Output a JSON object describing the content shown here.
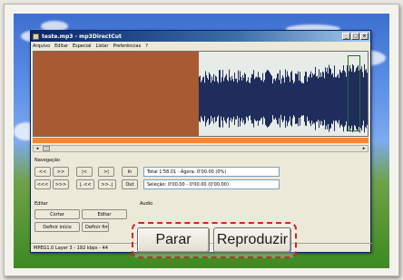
{
  "window": {
    "title": "teste.mp3 - mp3DirectCut",
    "controls": [
      "_",
      "□",
      "×"
    ]
  },
  "menu": [
    "Arquivo",
    "Editar",
    "Especial",
    "Listar",
    "Preferências",
    "?"
  ],
  "navigation": {
    "label": "Navegação",
    "row1": [
      "<<",
      ">>",
      "|<",
      ">|",
      "In"
    ],
    "row2": [
      "<<<",
      ">>>",
      "|..<<",
      ">>..|",
      "Out"
    ],
    "total_text": "Total 1'58.01 · Agora: 0'00.00  (0%)",
    "selection_text": "Seleção: 0'00.00 - 0'00.00 (0'00.00)"
  },
  "edit": {
    "label": "Editar",
    "cut": "Cortar",
    "edit": "Editar",
    "define_start": "Definir início",
    "define_end": "Definir fim"
  },
  "audio": {
    "label": "Audio"
  },
  "status": "MPEG1.0 Layer 3 - 192 kbps - 44",
  "callout": {
    "stop": "Parar",
    "play": "Reproduzir"
  },
  "icons": {
    "app": "app-icon",
    "minimize": "minimize-icon",
    "maximize": "maximize-icon",
    "close": "close-icon"
  },
  "colors": {
    "selection": "#a85a33",
    "waveform": "#1f2d5c",
    "timeline": "#ef8a2e",
    "callout_border": "#d2232a"
  }
}
